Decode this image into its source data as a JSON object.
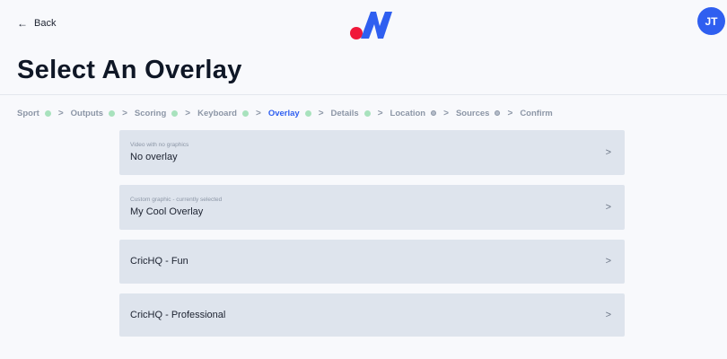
{
  "header": {
    "back_label": "Back",
    "back_icon": "left-arrow",
    "avatar_initials": "JT",
    "logo_colors": {
      "dot": "#f0183a",
      "mark": "#2f5ff0"
    }
  },
  "page_title": "Select An Overlay",
  "steps": [
    {
      "label": "Sport",
      "status": "done"
    },
    {
      "label": "Outputs",
      "status": "done"
    },
    {
      "label": "Scoring",
      "status": "done"
    },
    {
      "label": "Keyboard",
      "status": "done"
    },
    {
      "label": "Overlay",
      "status": "active"
    },
    {
      "label": "Details",
      "status": "done"
    },
    {
      "label": "Location",
      "status": "pending"
    },
    {
      "label": "Sources",
      "status": "pending"
    },
    {
      "label": "Confirm",
      "status": "none"
    }
  ],
  "options": [
    {
      "caption": "Video with no graphics",
      "label": "No overlay"
    },
    {
      "caption": "Custom graphic - currently selected",
      "label": "My Cool Overlay"
    },
    {
      "caption": "",
      "label": "CricHQ - Fun"
    },
    {
      "caption": "",
      "label": "CricHQ - Professional"
    }
  ],
  "chevron": ">",
  "step_separator": ">",
  "colors": {
    "accent": "#2f5ff0",
    "done_dot": "#a8e2bd",
    "card_bg": "#dee4ed"
  }
}
